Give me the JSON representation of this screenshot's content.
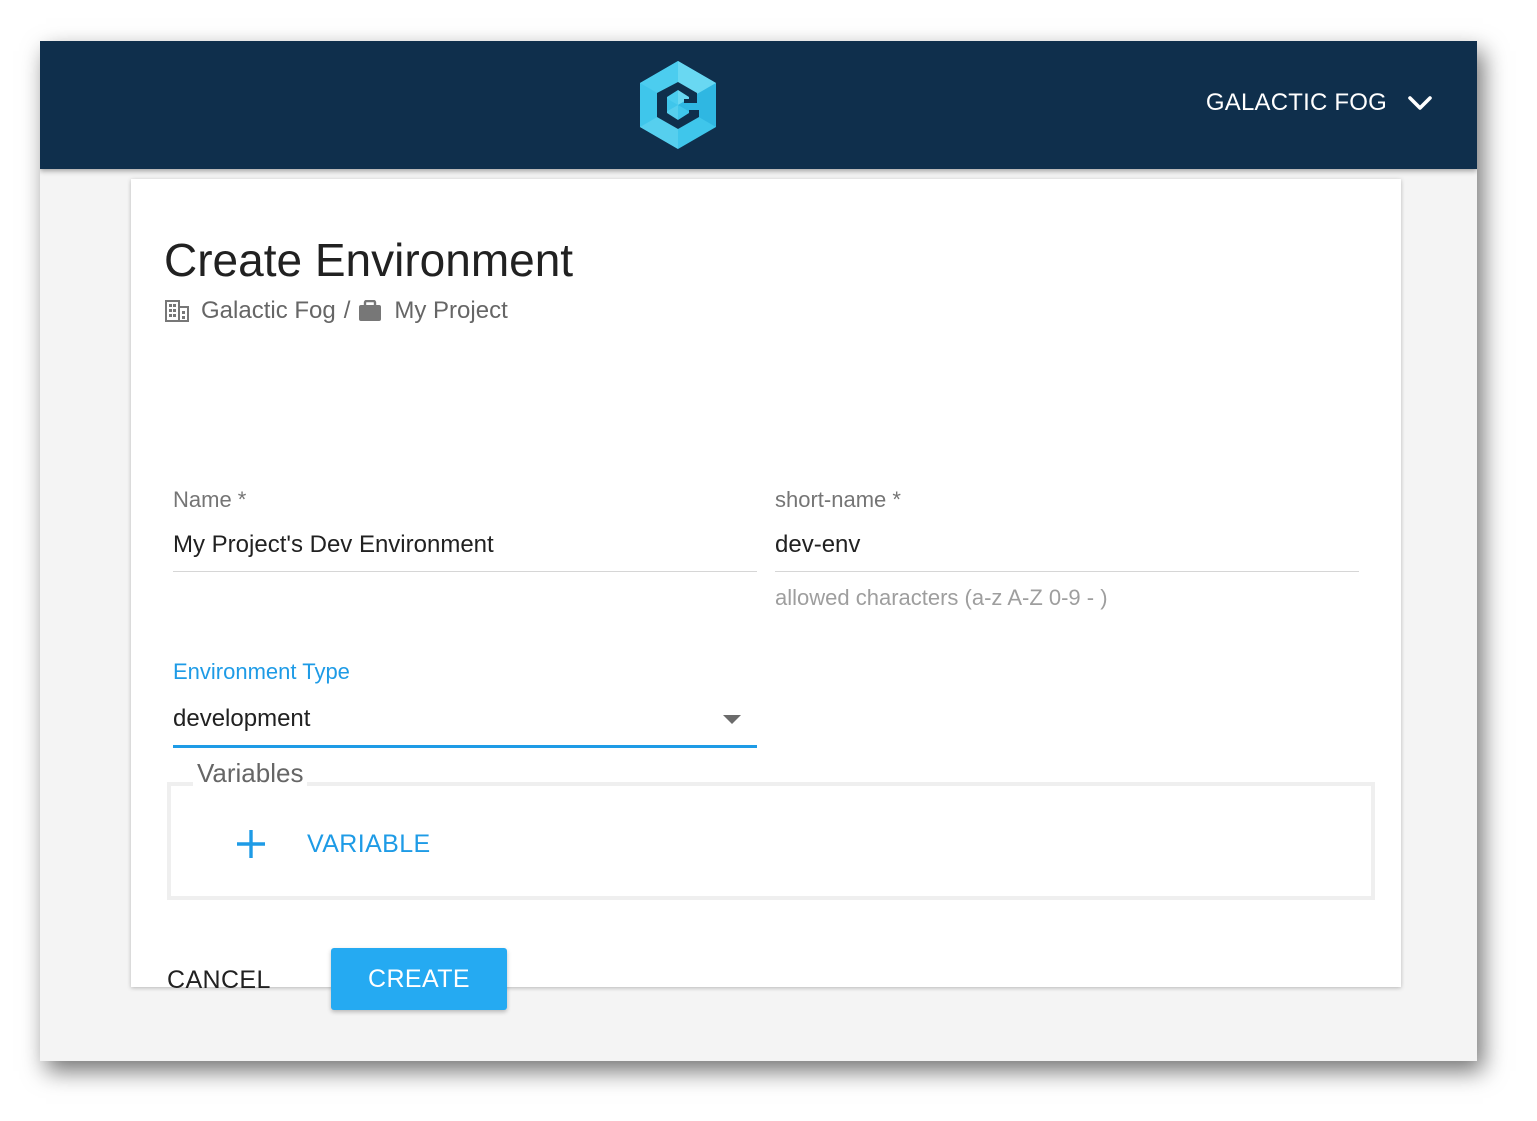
{
  "header": {
    "org_label": "GALACTIC FOG",
    "logo_icon": "galactic-fog-logo",
    "menu_icon": "chevron-down-icon",
    "bar_color": "#0f2f4c"
  },
  "page": {
    "title": "Create Environment",
    "breadcrumb": {
      "org_icon": "building-icon",
      "org": "Galactic Fog",
      "separator": "/",
      "project_icon": "briefcase-icon",
      "project": "My Project"
    }
  },
  "form": {
    "name": {
      "label": "Name *",
      "value": "My Project's Dev Environment"
    },
    "short_name": {
      "label": "short-name *",
      "value": "dev-env",
      "helper": "allowed characters (a-z A-Z 0-9 - )"
    },
    "environment_type": {
      "label": "Environment Type",
      "value": "development",
      "icon": "dropdown-caret-icon"
    },
    "variables": {
      "legend": "Variables",
      "add_label": "VARIABLE",
      "add_icon": "plus-icon"
    }
  },
  "actions": {
    "cancel_label": "CANCEL",
    "create_label": "CREATE"
  },
  "colors": {
    "accent": "#1e9be6",
    "primary_button": "#25aaf2"
  }
}
